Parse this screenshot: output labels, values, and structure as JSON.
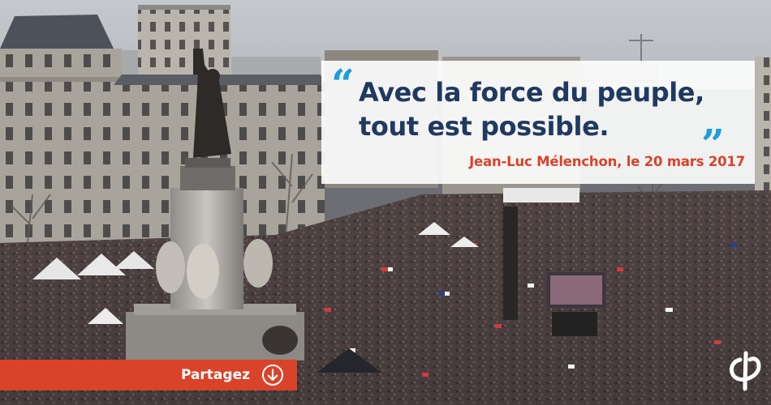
{
  "quote": {
    "open_mark": "“",
    "text": "Avec la force du peuple, tout est possible.",
    "close_mark": "”",
    "author": "Jean-Luc Mélenchon, le 20 mars 2017"
  },
  "share": {
    "label": "Partagez",
    "icon": "arrow-down-circle-icon"
  },
  "logo": {
    "icon": "phi-logo-icon"
  },
  "colors": {
    "quote_text": "#1f3960",
    "quote_marks": "#1b9fd9",
    "accent_red": "#d9432a",
    "card_bg": "#ffffff"
  }
}
